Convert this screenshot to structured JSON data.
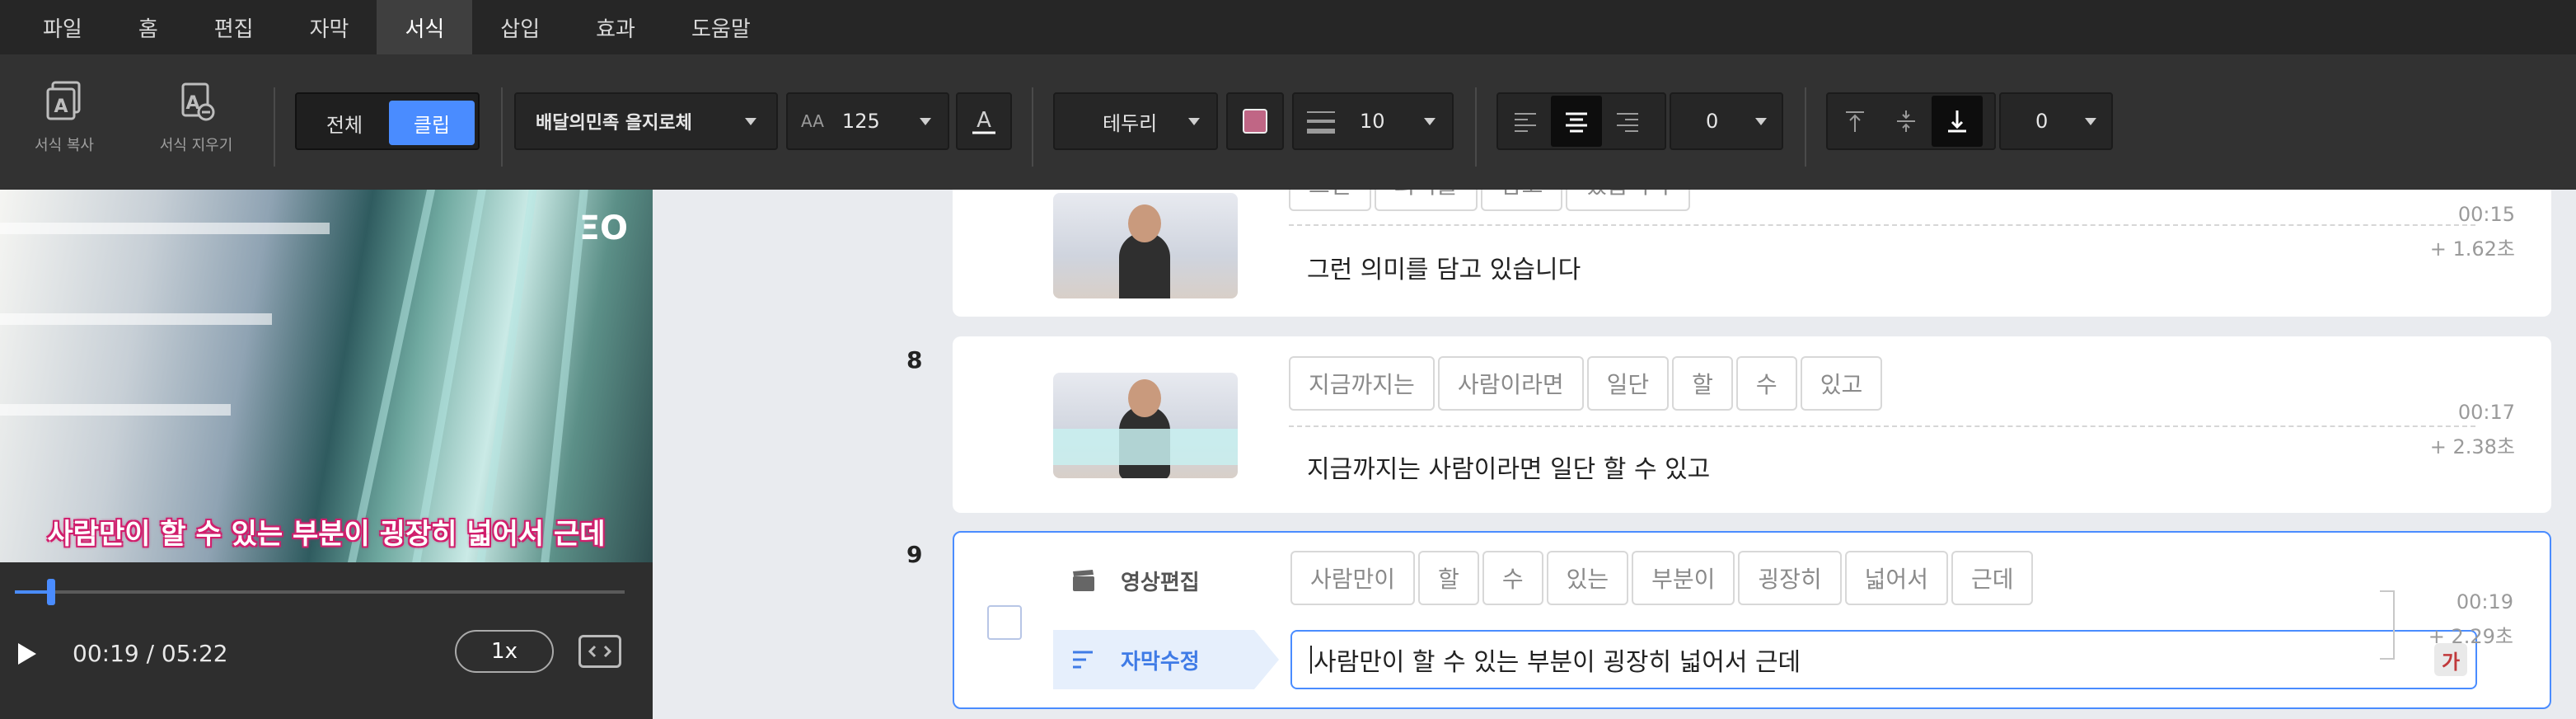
{
  "menu": {
    "items": [
      "파일",
      "홈",
      "편집",
      "자막",
      "서식",
      "삽입",
      "효과",
      "도움말"
    ],
    "active_index": 4
  },
  "toolbar": {
    "copy_format_label": "서식 복사",
    "clear_format_label": "서식 지우기",
    "scope": {
      "all_label": "전체",
      "clip_label": "클립",
      "selected": "클립"
    },
    "font_name": "배달의민족 을지로체",
    "font_size": "125",
    "border_label": "테두리",
    "border_color": "#c06685",
    "border_width": "10",
    "align_selected": "center",
    "align_value": "0",
    "valign_selected": "bottom",
    "valign_value": "0",
    "accent_color": "#4a8cff"
  },
  "preview": {
    "subtitle": "사람만이 할 수 있는 부분이 굉장히 넓어서 근데",
    "logo": "ΞO",
    "timecode": "00:19 / 05:22",
    "speed": "1x",
    "progress_fraction": 0.059
  },
  "rows": [
    {
      "number": "",
      "chips": [
        "그런",
        "의미를",
        "담고",
        "있습니다"
      ],
      "text": "그런 의미를 담고 있습니다",
      "time": "00:15",
      "duration": "+ 1.62초"
    },
    {
      "number": "8",
      "chips": [
        "지금까지는",
        "사람이라면",
        "일단",
        "할",
        "수",
        "있고"
      ],
      "text": "지금까지는 사람이라면 일단 할 수 있고",
      "time": "00:17",
      "duration": "+ 2.38초"
    },
    {
      "number": "9",
      "chips": [
        "사람만이",
        "할",
        "수",
        "있는",
        "부분이",
        "굉장히",
        "넓어서",
        "근데"
      ],
      "text": "사람만이 할 수 있는 부분이 굉장히 넓어서 근데",
      "time": "00:19",
      "duration": "+ 2.29초",
      "tag_video": "영상편집",
      "tag_subtitle": "자막수정",
      "ka_label": "가"
    }
  ]
}
